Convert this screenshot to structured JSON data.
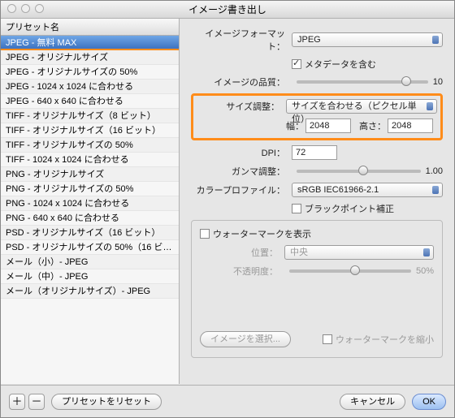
{
  "title": "イメージ書き出し",
  "sidebar": {
    "header": "プリセット名",
    "items": [
      "JPEG - 無料 MAX",
      "JPEG - オリジナルサイズ",
      "JPEG - オリジナルサイズの 50%",
      "JPEG - 1024 x 1024 に合わせる",
      "JPEG - 640 x 640 に合わせる",
      "TIFF - オリジナルサイズ（8 ビット）",
      "TIFF - オリジナルサイズ（16 ビット）",
      "TIFF - オリジナルサイズの 50%",
      "TIFF - 1024 x 1024 に合わせる",
      "PNG - オリジナルサイズ",
      "PNG - オリジナルサイズの 50%",
      "PNG - 1024 x 1024 に合わせる",
      "PNG - 640 x 640 に合わせる",
      "PSD - オリジナルサイズ（16 ビット）",
      "PSD - オリジナルサイズの 50%（16 ビッ…",
      "メール（小）- JPEG",
      "メール（中）- JPEG",
      "メール（オリジナルサイズ）- JPEG"
    ],
    "selected_index": 0
  },
  "format": {
    "label": "イメージフォーマット：",
    "value": "JPEG"
  },
  "meta": {
    "label": "メタデータを含む"
  },
  "quality": {
    "label": "イメージの品質：",
    "max": "10",
    "pos_pct": 80
  },
  "size": {
    "label": "サイズ調整：",
    "value": "サイズを合わせる（ピクセル単位）",
    "w_label": "幅：",
    "w_val": "2048",
    "h_label": "高さ：",
    "h_val": "2048"
  },
  "dpi": {
    "label": "DPI：",
    "value": "72"
  },
  "gamma": {
    "label": "ガンマ調整：",
    "value": "1.00",
    "pos_pct": 50
  },
  "profile": {
    "label": "カラープロファイル：",
    "value": "sRGB IEC61966-2.1"
  },
  "blackpoint": {
    "label": "ブラックポイント補正"
  },
  "watermark": {
    "show_label": "ウォーターマークを表示",
    "pos_label": "位置：",
    "pos_value": "中央",
    "opacity_label": "不透明度：",
    "opacity_value": "50%",
    "opacity_pos_pct": 50,
    "select_image": "イメージを選択...",
    "shrink": "ウォーターマークを縮小"
  },
  "buttons": {
    "add": "＋",
    "remove": "－",
    "reset": "プリセットをリセット",
    "cancel": "キャンセル",
    "ok": "OK"
  }
}
